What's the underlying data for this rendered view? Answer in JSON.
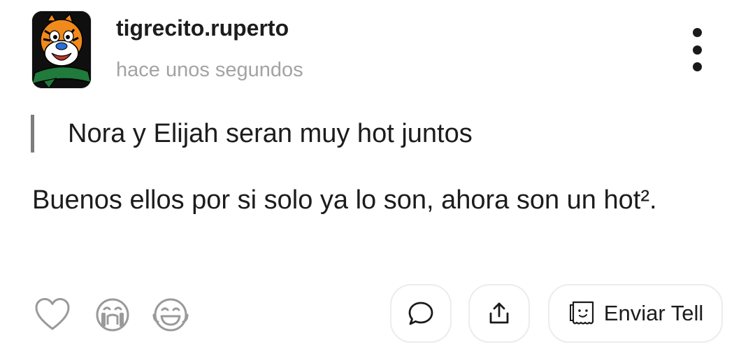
{
  "post": {
    "username": "tigrecito.ruperto",
    "timestamp": "hace unos segundos",
    "quote": "Nora y Elijah seran muy hot juntos",
    "body": "Buenos ellos por si solo ya lo son, ahora son un hot².",
    "avatar_icon": "tiger-mascot-avatar"
  },
  "reactions": [
    {
      "icon": "heart-icon"
    },
    {
      "icon": "crying-face-icon"
    },
    {
      "icon": "laughing-face-icon"
    }
  ],
  "actions": {
    "comment_icon": "comment-bubble-icon",
    "share_icon": "share-upload-icon",
    "send_tell_label": "Enviar Tell",
    "send_tell_icon": "tell-note-icon"
  },
  "menu_icon": "more-vertical-icon"
}
